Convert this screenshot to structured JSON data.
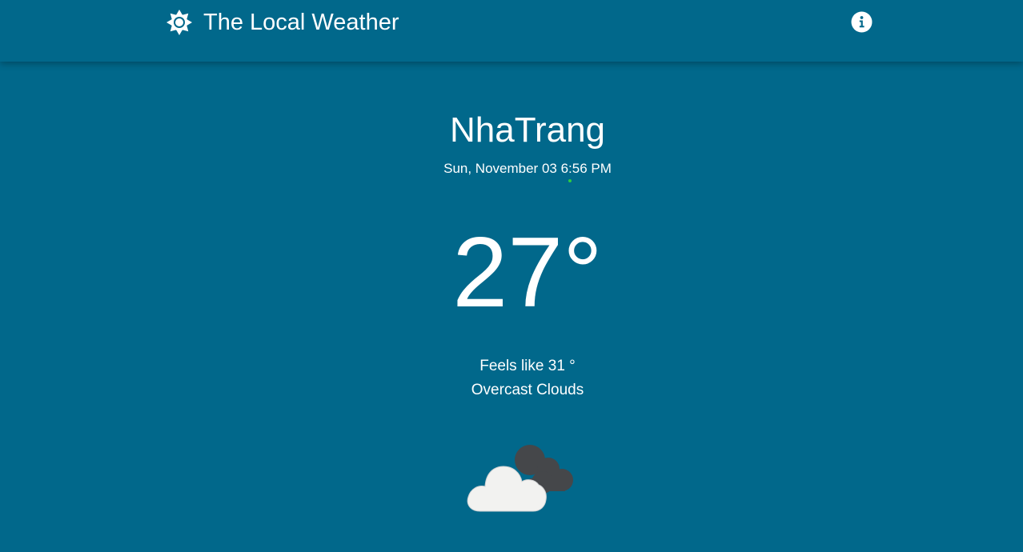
{
  "header": {
    "title": "The Local Weather",
    "logo_icon": "sun-gear-icon",
    "info_icon": "info-icon"
  },
  "weather": {
    "city": "NhaTrang",
    "datetime": "Sun, November 03 6:56 PM",
    "temperature": "27°",
    "feels_like": "Feels like 31 °",
    "description": "Overcast Clouds",
    "condition_icon": "overcast-clouds-icon"
  },
  "colors": {
    "background": "#01688b",
    "text": "#ffffff",
    "front_cloud": "#f2f2f0",
    "back_cloud": "#45474a",
    "indicator_dot": "#2ecc40"
  }
}
